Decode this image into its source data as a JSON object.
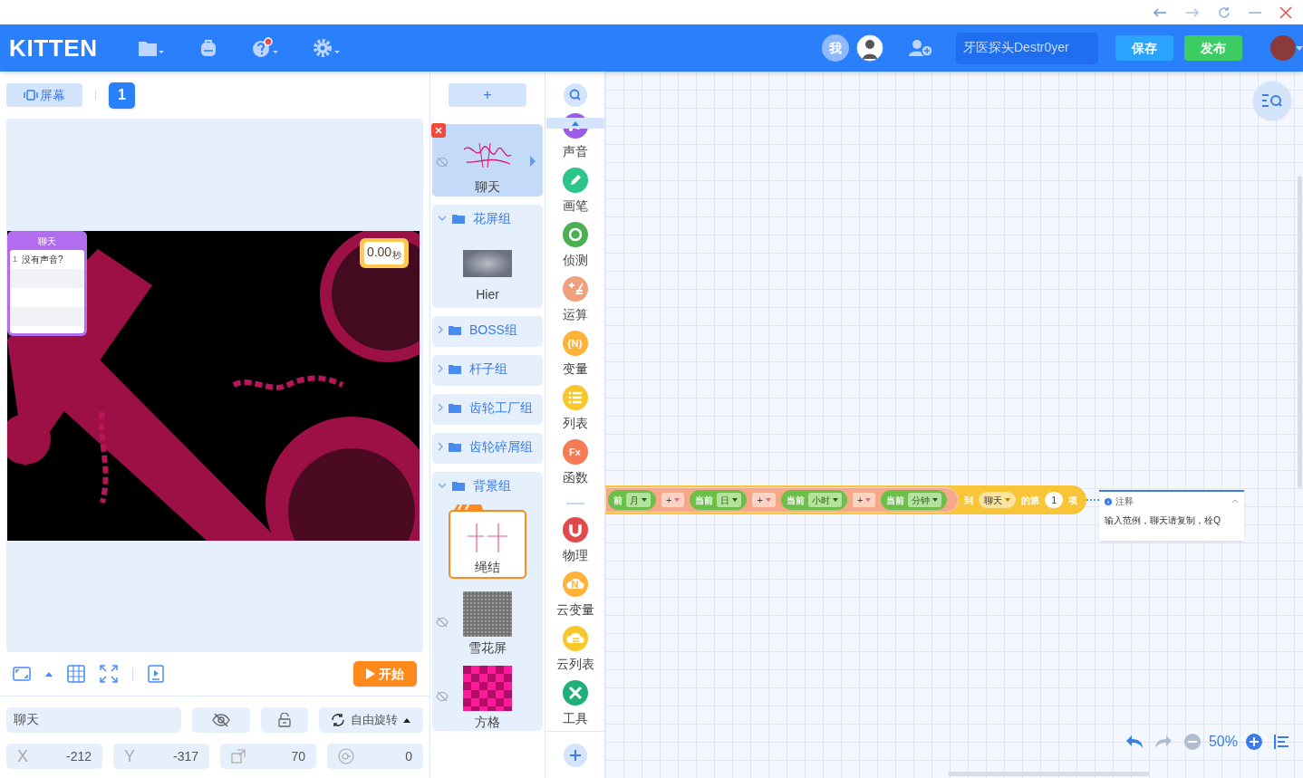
{
  "header": {
    "logo": "KITTEN",
    "collaborators": [
      {
        "kind": "initial",
        "text": "我"
      },
      {
        "kind": "avatar"
      }
    ],
    "project_name": "牙医探头Destr0yer",
    "buttons": [
      {
        "kind": "save",
        "label": "保存"
      },
      {
        "kind": "publish",
        "label": "发布"
      }
    ]
  },
  "stage_toolbar": {
    "screen_button": "屏幕",
    "screen_number": "1"
  },
  "stage": {
    "chat_monitor": {
      "title": "聊天",
      "rows": [
        {
          "index": "1",
          "text": "没有声音?"
        }
      ]
    },
    "timer": {
      "value": "0.00",
      "unit": "秒"
    }
  },
  "stage_controls": {
    "start_button": "开始"
  },
  "sprite_properties": {
    "name": "聊天",
    "visible": false,
    "locked": false,
    "rotation": "自由旋转",
    "fields": [
      {
        "kind": "x",
        "label": "X",
        "value": "-212"
      },
      {
        "kind": "y",
        "label": "Y",
        "value": "-317"
      },
      {
        "kind": "size",
        "value": "70"
      },
      {
        "kind": "direction",
        "value": "0"
      }
    ]
  },
  "add_sprite_button": "+",
  "sprites": [
    {
      "kind": "sprite",
      "name": "聊天",
      "selected": true,
      "hidden": true,
      "background": false
    },
    {
      "kind": "group",
      "name": "花屏组",
      "expanded": true,
      "children": [
        {
          "kind": "sprite",
          "name": "Hier",
          "selected": false,
          "hidden": false,
          "background": false
        }
      ]
    },
    {
      "kind": "group",
      "name": "BOSS组",
      "expanded": false
    },
    {
      "kind": "group",
      "name": "杆子组",
      "expanded": false
    },
    {
      "kind": "group",
      "name": "齿轮工厂组",
      "expanded": false
    },
    {
      "kind": "group",
      "name": "齿轮碎屑组",
      "expanded": false
    },
    {
      "kind": "group",
      "name": "背景组",
      "expanded": true,
      "children": [
        {
          "kind": "sprite",
          "name": "绳结",
          "selected": false,
          "hidden": false,
          "background": true
        },
        {
          "kind": "sprite",
          "name": "雪花屏",
          "selected": false,
          "hidden": true,
          "background": false
        },
        {
          "kind": "sprite",
          "name": "方格",
          "selected": false,
          "hidden": true,
          "background": false
        }
      ]
    }
  ],
  "categories": [
    {
      "kind": "category",
      "name": "声音",
      "color": "#9b5de5"
    },
    {
      "kind": "category",
      "name": "画笔",
      "color": "#2bc48a"
    },
    {
      "kind": "category",
      "name": "侦测",
      "color": "#4caf50"
    },
    {
      "kind": "category",
      "name": "运算",
      "color": "#f0a07c"
    },
    {
      "kind": "category",
      "name": "变量",
      "color": "#ffb238",
      "glyph": "{N}"
    },
    {
      "kind": "category",
      "name": "列表",
      "color": "#f7c72b"
    },
    {
      "kind": "category",
      "name": "函数",
      "color": "#f57b54",
      "glyph": "Fx"
    },
    {
      "kind": "divider"
    },
    {
      "kind": "category",
      "name": "物理",
      "color": "#e04a4a"
    },
    {
      "kind": "category",
      "name": "云变量",
      "color": "#ffb238",
      "glyph": "N"
    },
    {
      "kind": "category",
      "name": "云列表",
      "color": "#f7c72b"
    },
    {
      "kind": "category",
      "name": "工具",
      "color": "#1fb07a"
    }
  ],
  "script": {
    "segments": [
      {
        "kind": "reporter",
        "label": "前",
        "dropdown": "月"
      },
      {
        "kind": "operator",
        "text": "+"
      },
      {
        "kind": "reporter",
        "label": "当前",
        "dropdown": "日"
      },
      {
        "kind": "operator",
        "text": "+"
      },
      {
        "kind": "reporter",
        "label": "当前",
        "dropdown": "小时"
      },
      {
        "kind": "operator",
        "text": "+"
      },
      {
        "kind": "reporter",
        "label": "当前",
        "dropdown": "分钟"
      }
    ],
    "tail": [
      {
        "kind": "text",
        "text": "到"
      },
      {
        "kind": "dropdown",
        "text": "聊天"
      },
      {
        "kind": "text",
        "text": "的第"
      },
      {
        "kind": "number",
        "text": "1"
      },
      {
        "kind": "text",
        "text": "项"
      }
    ]
  },
  "comment": {
    "title": "注释",
    "text": "输入范例，聊天请复制，栓Q"
  },
  "zoom": {
    "level": "50%"
  }
}
